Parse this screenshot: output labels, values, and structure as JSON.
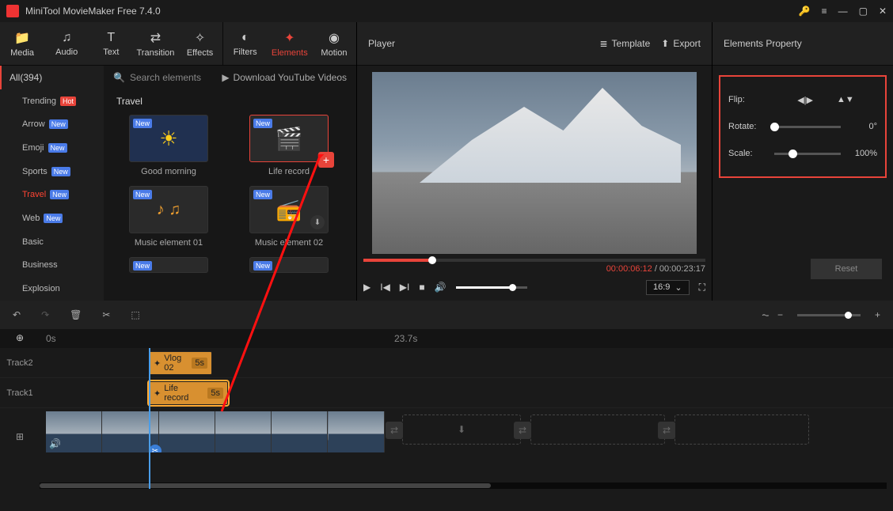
{
  "titlebar": {
    "title": "MiniTool MovieMaker Free 7.4.0"
  },
  "topnav": {
    "items": [
      {
        "label": "Media",
        "icon": "folder"
      },
      {
        "label": "Audio",
        "icon": "music"
      },
      {
        "label": "Text",
        "icon": "text"
      },
      {
        "label": "Transition",
        "icon": "transition"
      },
      {
        "label": "Effects",
        "icon": "sparkle"
      },
      {
        "label": "Filters",
        "icon": "filter"
      },
      {
        "label": "Elements",
        "icon": "elements",
        "active": true
      },
      {
        "label": "Motion",
        "icon": "motion"
      }
    ]
  },
  "sidebar": {
    "head": "All(394)",
    "items": [
      {
        "label": "Trending",
        "badge": "Hot",
        "badge_type": "hot"
      },
      {
        "label": "Arrow",
        "badge": "New",
        "badge_type": "new"
      },
      {
        "label": "Emoji",
        "badge": "New",
        "badge_type": "new"
      },
      {
        "label": "Sports",
        "badge": "New",
        "badge_type": "new"
      },
      {
        "label": "Travel",
        "badge": "New",
        "badge_type": "new",
        "active": true
      },
      {
        "label": "Web",
        "badge": "New",
        "badge_type": "new"
      },
      {
        "label": "Basic"
      },
      {
        "label": "Business"
      },
      {
        "label": "Explosion"
      }
    ]
  },
  "grid": {
    "search_placeholder": "Search elements",
    "download_link": "Download YouTube Videos",
    "section_title": "Travel",
    "items": [
      {
        "name": "Good morning",
        "tag": "New"
      },
      {
        "name": "Life record",
        "tag": "New",
        "selected": true
      },
      {
        "name": "Music element 01",
        "tag": "New"
      },
      {
        "name": "Music element 02",
        "tag": "New",
        "downloadable": true
      }
    ]
  },
  "player": {
    "title": "Player",
    "template_label": "Template",
    "export_label": "Export",
    "current_time": "00:00:06:12",
    "total_time": "00:00:23:17",
    "ratio": "16:9"
  },
  "properties": {
    "title": "Elements Property",
    "flip_label": "Flip:",
    "rotate_label": "Rotate:",
    "rotate_value": "0°",
    "scale_label": "Scale:",
    "scale_value": "100%",
    "reset_label": "Reset"
  },
  "timeline": {
    "start_label": "0s",
    "mid_label": "23.7s",
    "tracks": {
      "track2": "Track2",
      "track1": "Track1"
    },
    "clips": {
      "vlog": {
        "name": "Vlog 02",
        "duration": "5s"
      },
      "life": {
        "name": "Life record",
        "duration": "5s"
      }
    }
  }
}
